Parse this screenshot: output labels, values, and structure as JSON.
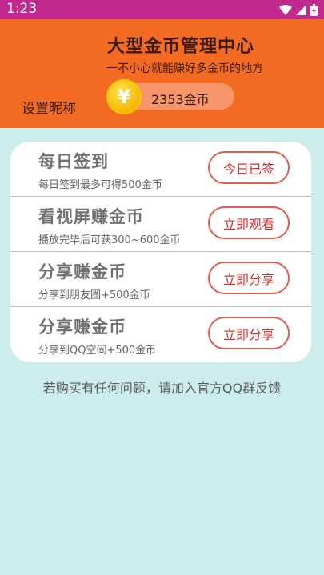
{
  "status_bar": {
    "time": "1:23"
  },
  "header": {
    "title": "大型金币管理中心",
    "subtitle": "一不小心就能赚好多金币的地方",
    "nickname_link": "设置昵称",
    "coin_symbol": "¥",
    "coin_amount": "2353金币"
  },
  "tasks": [
    {
      "title": "每日签到",
      "subtitle": "每日签到最多可得500金币",
      "button": "今日已签"
    },
    {
      "title": "看视屏赚金币",
      "subtitle": "播放完毕后可获300~600金币",
      "button": "立即观看"
    },
    {
      "title": "分享赚金币",
      "subtitle": "分享到朋友圈+500金币",
      "button": "立即分享"
    },
    {
      "title": "分享赚金币",
      "subtitle": "分享到QQ空间+500金币",
      "button": "立即分享"
    }
  ],
  "footer": {
    "text": "若购买有任何问题，请加入官方QQ群反馈"
  },
  "colors": {
    "status_bar": "#c2298f",
    "header": "#f36a22",
    "background": "#cdecec",
    "button_border": "#e05e4c"
  }
}
